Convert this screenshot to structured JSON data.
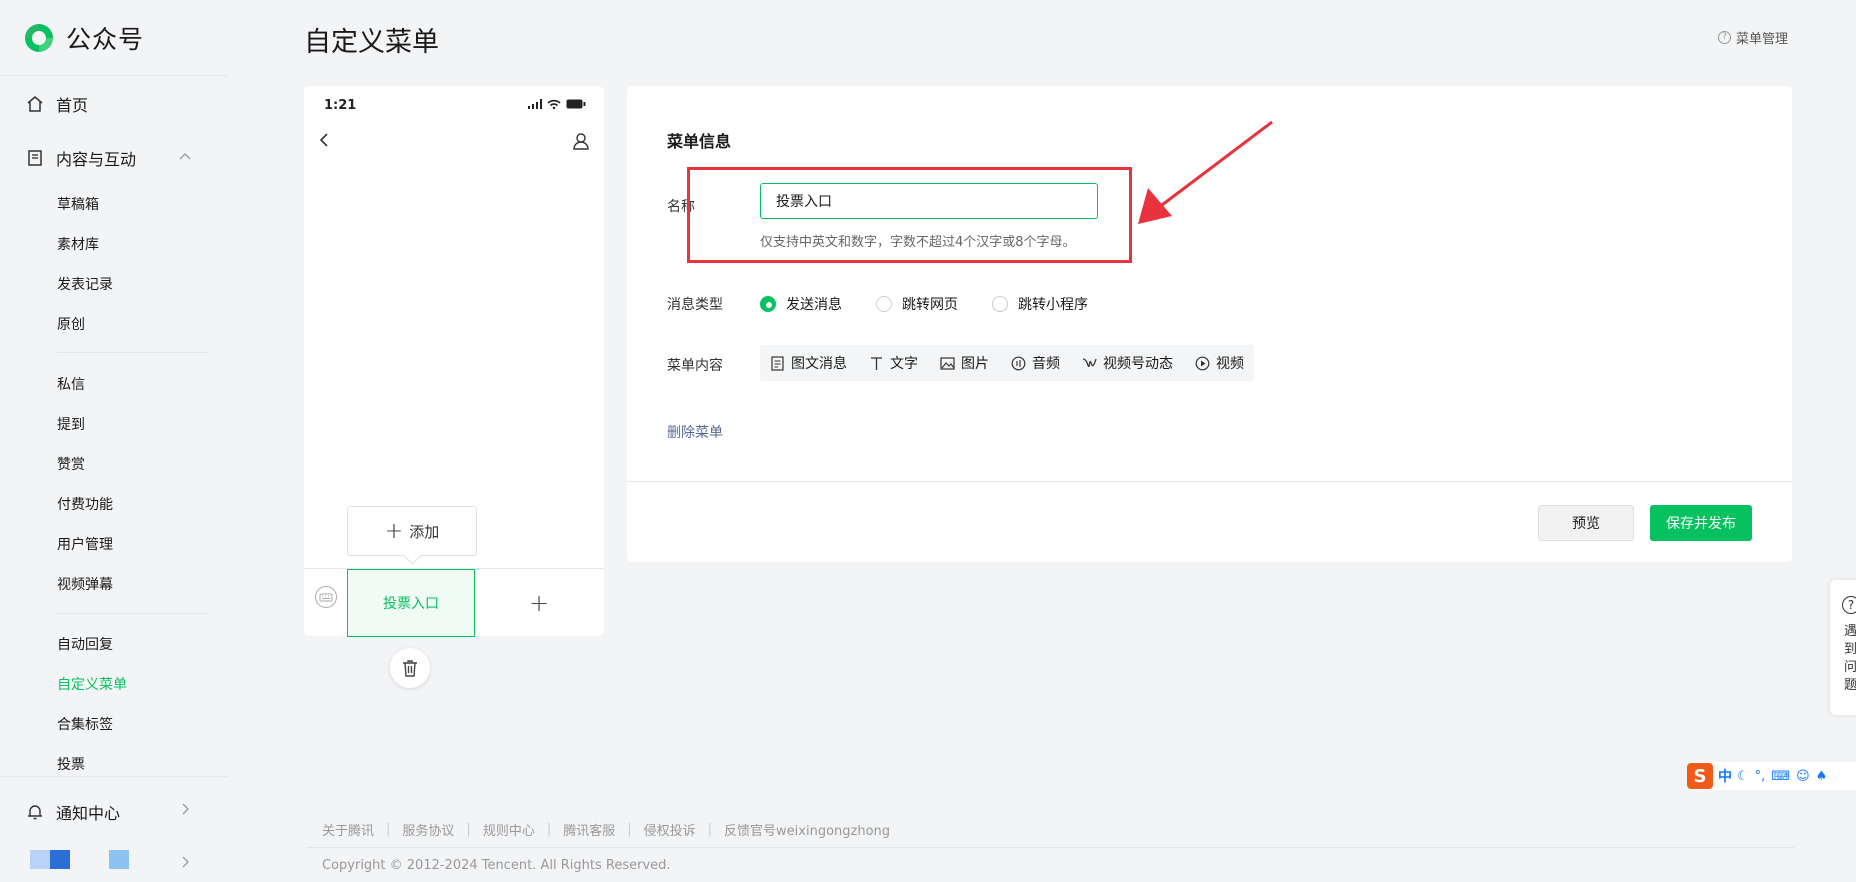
{
  "app": {
    "name": "公众号"
  },
  "sidebar": {
    "home": "首页",
    "content_section": "内容与互动",
    "items_group1": [
      "草稿箱",
      "素材库",
      "发表记录",
      "原创"
    ],
    "items_group2": [
      "私信",
      "提到",
      "赞赏",
      "付费功能",
      "用户管理",
      "视频弹幕"
    ],
    "items_group3": [
      "自动回复",
      "自定义菜单",
      "合集标签",
      "投票"
    ],
    "active_item": "自定义菜单",
    "notifications": "通知中心"
  },
  "header": {
    "title": "自定义菜单",
    "menu_mgmt": "菜单管理"
  },
  "phone": {
    "time": "1:21",
    "add_label": "添加",
    "menu_item": "投票入口",
    "add_symbol": "+"
  },
  "editor": {
    "section_title": "菜单信息",
    "name_label": "名称",
    "name_value": "投票入口",
    "name_hint": "仅支持中英文和数字，字数不超过4个汉字或8个字母。",
    "msg_type_label": "消息类型",
    "msg_types": [
      "发送消息",
      "跳转网页",
      "跳转小程序"
    ],
    "msg_type_selected": "发送消息",
    "content_label": "菜单内容",
    "content_tabs": [
      "图文消息",
      "文字",
      "图片",
      "音频",
      "视频号动态",
      "视频"
    ],
    "delete_label": "删除菜单",
    "preview_label": "预览",
    "publish_label": "保存并发布"
  },
  "footer": {
    "links": [
      "关于腾讯",
      "服务协议",
      "规则中心",
      "腾讯客服",
      "侵权投诉",
      "反馈官号weixingongzhong"
    ],
    "copyright": "Copyright © 2012-2024 Tencent. All Rights Reserved."
  },
  "help": {
    "q": "?",
    "text": "遇到问题"
  },
  "ime": {
    "logo": "S",
    "mode": "中"
  },
  "colors": {
    "accent": "#07c160",
    "link": "#576b95",
    "annotation": "#e8323c"
  }
}
